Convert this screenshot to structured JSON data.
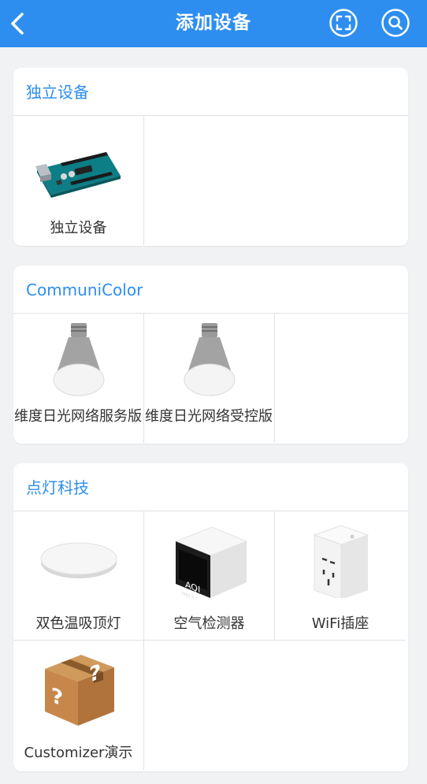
{
  "header": {
    "title": "添加设备"
  },
  "colors": {
    "accent": "#2e8ef0",
    "background": "#f1f2f4"
  },
  "sections": [
    {
      "title": "独立设备",
      "items": [
        {
          "label": "独立设备",
          "icon": "arduino-board-icon"
        }
      ]
    },
    {
      "title": "CommuniColor",
      "items": [
        {
          "label": "维度日光网络服务版",
          "icon": "led-bulb-icon"
        },
        {
          "label": "维度日光网络受控版",
          "icon": "led-bulb-icon"
        }
      ]
    },
    {
      "title": "点灯科技",
      "items": [
        {
          "label": "双色温吸顶灯",
          "icon": "ceiling-light-icon"
        },
        {
          "label": "空气检测器",
          "icon": "air-monitor-icon"
        },
        {
          "label": "WiFi插座",
          "icon": "smart-plug-icon"
        },
        {
          "label": "Customizer演示",
          "icon": "mystery-box-icon"
        }
      ]
    }
  ],
  "air_monitor_screen": {
    "line1": "AQI",
    "line2": "PM2.5 136"
  }
}
